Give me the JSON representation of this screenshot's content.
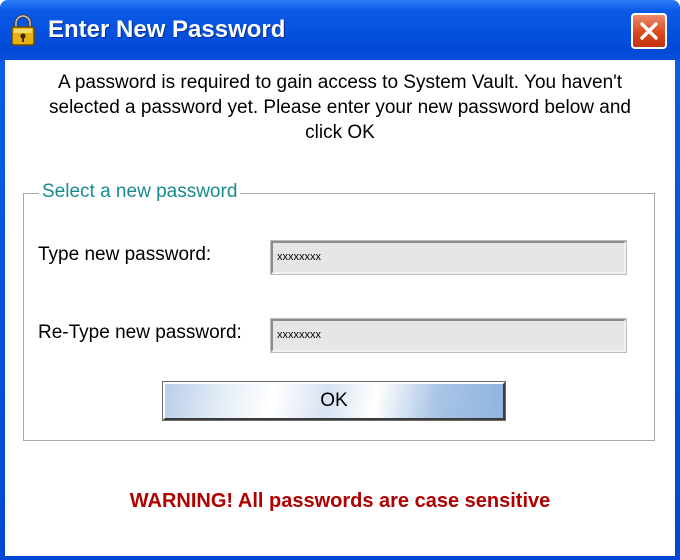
{
  "window": {
    "title": "Enter New Password",
    "icon": "lock-icon",
    "close_icon": "close-icon"
  },
  "intro": {
    "line1": "A password is required to gain access to System Vault. You haven't",
    "line2": "selected a password yet. Please enter your new password below and",
    "line3": "click OK"
  },
  "group": {
    "legend": "Select a new password",
    "new_password_label": "Type new password:",
    "new_password_value": "xxxxxxxx",
    "retype_password_label": "Re-Type new password:",
    "retype_password_value": "xxxxxxxx",
    "ok_label": "OK"
  },
  "warning": "WARNING! All passwords are case sensitive",
  "colors": {
    "titlebar": "#0552e0",
    "legend": "#1a8a8a",
    "warning": "#b00000",
    "close": "#d9491f"
  }
}
